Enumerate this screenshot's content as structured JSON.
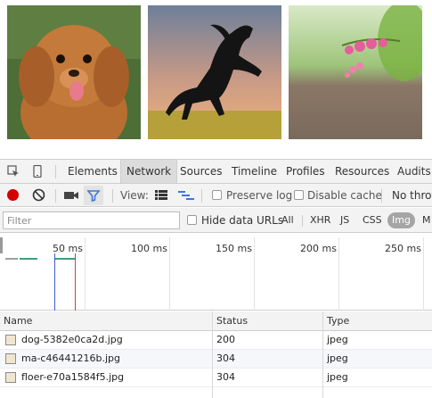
{
  "images": [
    {
      "name": "dog",
      "colors": {
        "bg": "#4d6e36",
        "fur": "#c47a3a",
        "fur_dark": "#9a5424",
        "tongue": "#e77b8b"
      }
    },
    {
      "name": "horse",
      "colors": {
        "sky_top": "#6e7f9a",
        "sky_bottom": "#f0b27a",
        "ground": "#b6a03a",
        "horse": "#141414"
      }
    },
    {
      "name": "flower",
      "colors": {
        "bg_top": "#d9e9c7",
        "bg_mid": "#9ec47a",
        "ground": "#8a7766",
        "blossom": "#e55d9b",
        "leaf": "#7bb342"
      }
    }
  ],
  "tabs": {
    "items": [
      {
        "label": "Elements",
        "active": false
      },
      {
        "label": "Network",
        "active": true
      },
      {
        "label": "Sources",
        "active": false
      },
      {
        "label": "Timeline",
        "active": false
      },
      {
        "label": "Profiles",
        "active": false
      },
      {
        "label": "Resources",
        "active": false
      },
      {
        "label": "Audits",
        "active": false
      }
    ]
  },
  "toolbar": {
    "view_label": "View:",
    "preserve_log": "Preserve log",
    "disable_cache": "Disable cache",
    "no_throttling": "No thrott",
    "record_color": "#d50000",
    "filter_active_color": "#3c78d8"
  },
  "filter": {
    "placeholder": "Filter",
    "hide_data_urls": "Hide data URLs",
    "types": [
      {
        "label": "All",
        "active": false
      },
      {
        "label": "XHR",
        "active": false
      },
      {
        "label": "JS",
        "active": false
      },
      {
        "label": "CSS",
        "active": false
      },
      {
        "label": "Img",
        "active": true
      },
      {
        "label": "M",
        "active": false
      }
    ]
  },
  "timeline": {
    "ticks": [
      "50 ms",
      "100 ms",
      "150 ms",
      "200 ms",
      "250 ms"
    ]
  },
  "grid": {
    "columns": [
      "Name",
      "Status",
      "Type"
    ],
    "rows": [
      {
        "name": "dog-5382e0ca2d.jpg",
        "status": "200",
        "type": "jpeg"
      },
      {
        "name": "ma-c46441216b.jpg",
        "status": "304",
        "type": "jpeg"
      },
      {
        "name": "floer-e70a1584f5.jpg",
        "status": "304",
        "type": "jpeg"
      }
    ]
  }
}
